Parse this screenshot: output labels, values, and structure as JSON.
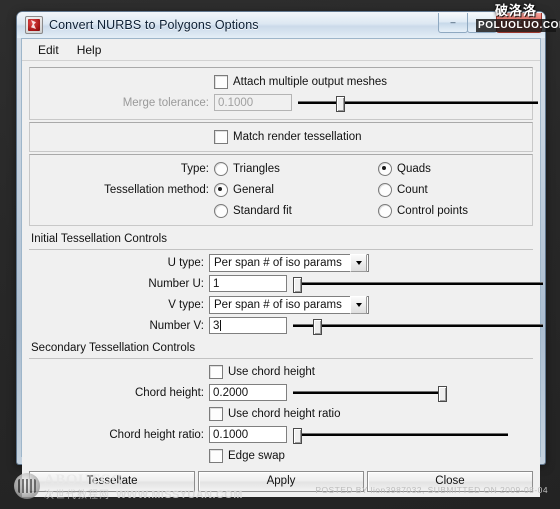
{
  "window": {
    "title": "Convert NURBS to Polygons Options",
    "app_icon": "maya-app-icon",
    "buttons": {
      "minimize": "–",
      "maximize": "▭",
      "close": "✕"
    }
  },
  "watermark": {
    "cn": "破洛洛",
    "en": "POLUOLUO.COM"
  },
  "menubar": {
    "items": [
      {
        "label": "Edit"
      },
      {
        "label": "Help"
      }
    ]
  },
  "section_general": {
    "attach_meshes": {
      "label": "Attach multiple output meshes",
      "checked": false
    },
    "merge_tolerance": {
      "label": "Merge tolerance:",
      "value": "0.1000",
      "disabled": true,
      "slider_pct": 18
    },
    "match_render": {
      "label": "Match render tessellation",
      "checked": false
    }
  },
  "section_type": {
    "type_label": "Type:",
    "method_label": "Tessellation method:",
    "left_options": [
      {
        "label": "Triangles",
        "selected": false
      },
      {
        "label": "General",
        "selected": true
      },
      {
        "label": "Standard fit",
        "selected": false
      }
    ],
    "right_options": [
      {
        "label": "Quads",
        "selected": true
      },
      {
        "label": "Count",
        "selected": false
      },
      {
        "label": "Control points",
        "selected": false
      }
    ]
  },
  "section_initial": {
    "title": "Initial Tessellation Controls",
    "u_type": {
      "label": "U type:",
      "value": "Per span # of iso params"
    },
    "number_u": {
      "label": "Number U:",
      "value": "1",
      "slider_pct": 1
    },
    "v_type": {
      "label": "V type:",
      "value": "Per span # of iso params"
    },
    "number_v": {
      "label": "Number V:",
      "value": "3",
      "slider_pct": 10
    }
  },
  "section_secondary": {
    "title": "Secondary Tessellation Controls",
    "use_chord_height": {
      "label": "Use chord height",
      "checked": false
    },
    "chord_height": {
      "label": "Chord height:",
      "value": "0.2000",
      "slider_pct": 100
    },
    "use_chord_height_ratio": {
      "label": "Use chord height ratio",
      "checked": false
    },
    "chord_height_ratio": {
      "label": "Chord height ratio:",
      "value": "0.1000",
      "slider_pct": 1
    },
    "edge_swap": {
      "label": "Edge swap",
      "checked": false
    }
  },
  "footer_buttons": [
    {
      "label": "Tessellate"
    },
    {
      "label": "Apply"
    },
    {
      "label": "Close"
    }
  ],
  "page_footer": {
    "logo_main": "ABOUTCG",
    "logo_cn": "次世代教程网",
    "logo_url": "WWW.MISSYUAN.COM",
    "posted": "POSTED BY lion3987032, SUBMITTED ON 2009-08-04"
  }
}
